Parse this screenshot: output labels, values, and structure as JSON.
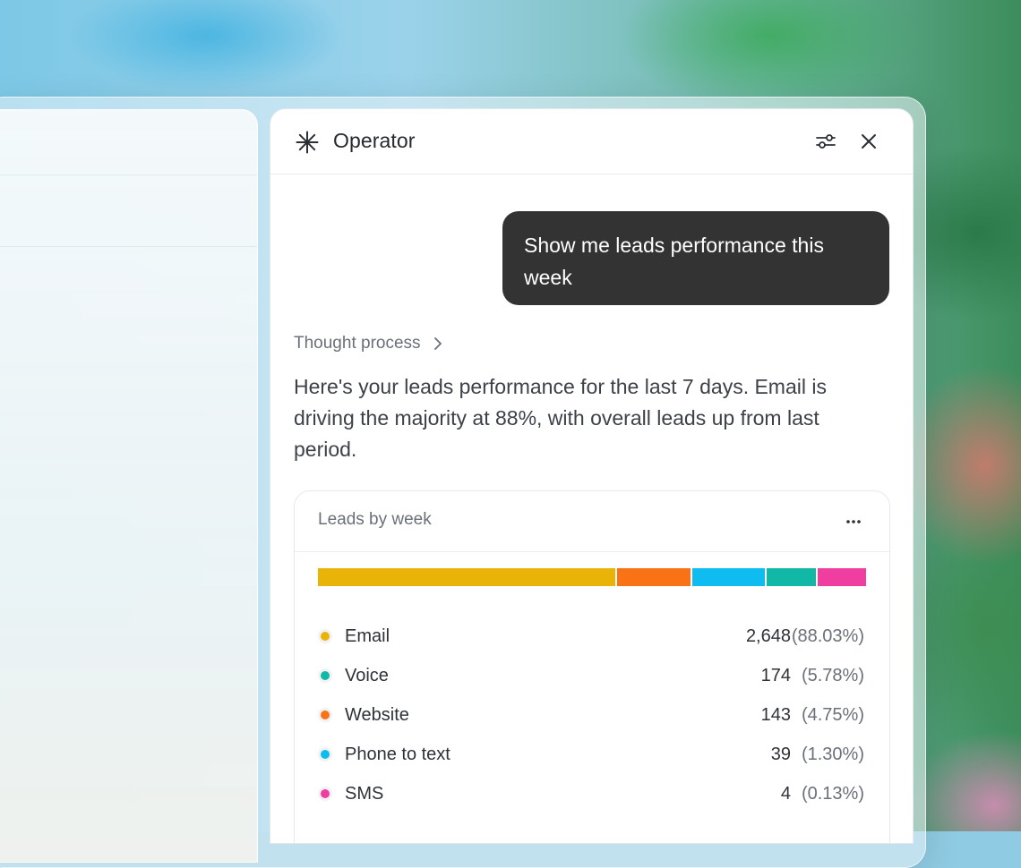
{
  "panel": {
    "title": "Operator",
    "icons": {
      "brand": "asterisk-icon",
      "settings": "sliders-icon",
      "close": "close-icon"
    }
  },
  "chat": {
    "user_message": "Show me leads performance this week",
    "thought_label": "Thought process",
    "reply": "Here's your leads performance for the last 7 days. Email is driving the majority at 88%, with overall leads up from last period."
  },
  "card": {
    "title": "Leads by week",
    "more_icon": "more-horizontal-icon"
  },
  "chart_data": {
    "type": "bar",
    "title": "Leads by week",
    "stacked": true,
    "categories": [
      "Email",
      "Voice",
      "Website",
      "Phone to text",
      "SMS"
    ],
    "values": [
      2648,
      174,
      143,
      39,
      4
    ],
    "percent_labels": [
      "(88.03%)",
      "(5.78%)",
      "(4.75%)",
      "(1.30%)",
      "(0.13%)"
    ],
    "value_labels": [
      "2,648",
      "174",
      "143",
      "39",
      "4"
    ],
    "bar_order": [
      "Email",
      "Website",
      "Phone to text",
      "Voice",
      "SMS"
    ],
    "bar_shares": [
      0.55,
      0.135,
      0.135,
      0.09,
      0.09
    ],
    "colors": {
      "Email": "#eab308",
      "Voice": "#12b8a6",
      "Website": "#f97316",
      "Phone to text": "#0ebcf0",
      "SMS": "#f03ea0"
    }
  }
}
